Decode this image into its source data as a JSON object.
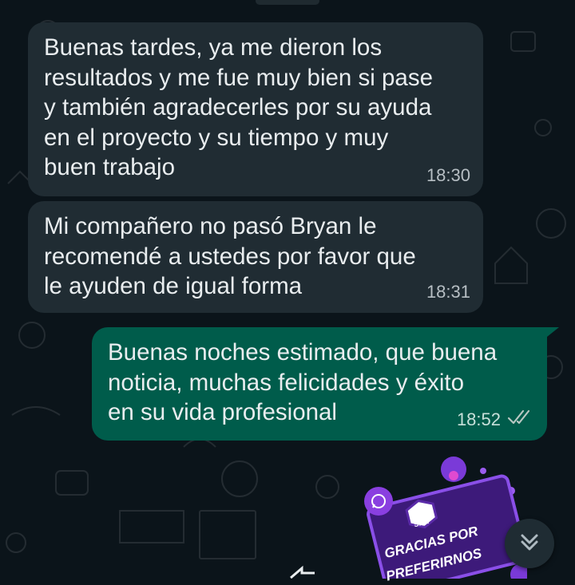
{
  "messages": [
    {
      "direction": "in",
      "text": "Buenas tardes, ya me dieron los\nresultados y me fue muy bien si pase\ny también agradecerles por su ayuda\nen el proyecto y su tiempo y muy\nbuen trabajo",
      "time": "18:30"
    },
    {
      "direction": "in",
      "text": "Mi compañero no pasó Bryan le\nrecomendé a ustedes por favor que\nle ayuden de igual forma",
      "time": "18:31"
    },
    {
      "direction": "out",
      "text": "Buenas noches estimado, que buena\nnoticia, muchas felicidades y éxito\nen su vida profesional",
      "time": "18:52",
      "status": "read"
    }
  ],
  "sticker": {
    "line1": "GRACIAS POR",
    "line2": "PREFERIRNOS",
    "logo": "SIDT"
  },
  "icons": {
    "read_receipt": "double-check-icon",
    "scroll_down": "chevron-double-down-icon",
    "whatsapp": "whatsapp-icon"
  },
  "colors": {
    "background": "#0b141a",
    "incoming": "#202c33",
    "outgoing": "#005c4b",
    "sticker": "#3d1a7a"
  }
}
